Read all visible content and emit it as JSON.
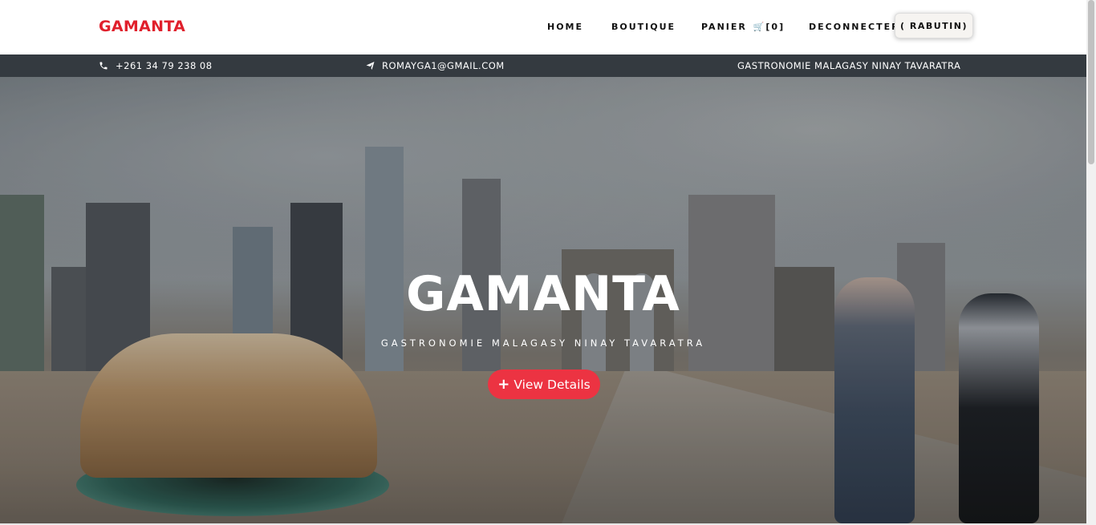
{
  "navbar": {
    "brand": "GAMANTA",
    "items": [
      {
        "label": "HOME"
      },
      {
        "label": "BOUTIQUE"
      },
      {
        "label": "PANIER"
      },
      {
        "label": "DECONNECTER"
      }
    ],
    "cart_count": "[0]",
    "user_button": "( RABUTIN)"
  },
  "topbar": {
    "phone": "+261 34 79 238 08",
    "email": "ROMAYGA1@GMAIL.COM",
    "tagline": "GASTRONOMIE MALAGASY NINAY TAVARATRA"
  },
  "hero": {
    "title": "GAMANTA",
    "subtitle": "GASTRONOMIE MALAGASY NINAY TAVARATRA",
    "button_label": "View Details"
  },
  "colors": {
    "brand": "#e0202c",
    "button": "#ec3342",
    "topbar_bg": "#343a40"
  },
  "icons": [
    "phone-icon",
    "send-icon",
    "cart-icon",
    "plus-icon"
  ]
}
